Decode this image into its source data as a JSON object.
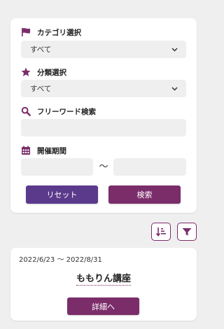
{
  "colors": {
    "accent": "#7b2d6a",
    "reset_button": "#5b3a8c",
    "field_bg": "#efefef",
    "page_bg": "#efefef"
  },
  "search": {
    "category": {
      "icon": "flag-icon",
      "label": "カテゴリ選択",
      "selected": "すべて"
    },
    "classification": {
      "icon": "star-icon",
      "label": "分類選択",
      "selected": "すべて"
    },
    "freeword": {
      "icon": "search-icon",
      "label": "フリーワード検索",
      "value": "",
      "placeholder": ""
    },
    "period": {
      "icon": "calendar-icon",
      "label": "開催期間",
      "from_value": "",
      "to_value": "",
      "separator": "〜"
    },
    "reset_label": "リセット",
    "search_label": "検索"
  },
  "toolbar": {
    "sort_icon": "sort-icon",
    "filter_icon": "filter-icon"
  },
  "results": [
    {
      "period": "2022/6/23 〜 2022/8/31",
      "title": "ももりん講座",
      "detail_label": "詳細へ"
    }
  ]
}
